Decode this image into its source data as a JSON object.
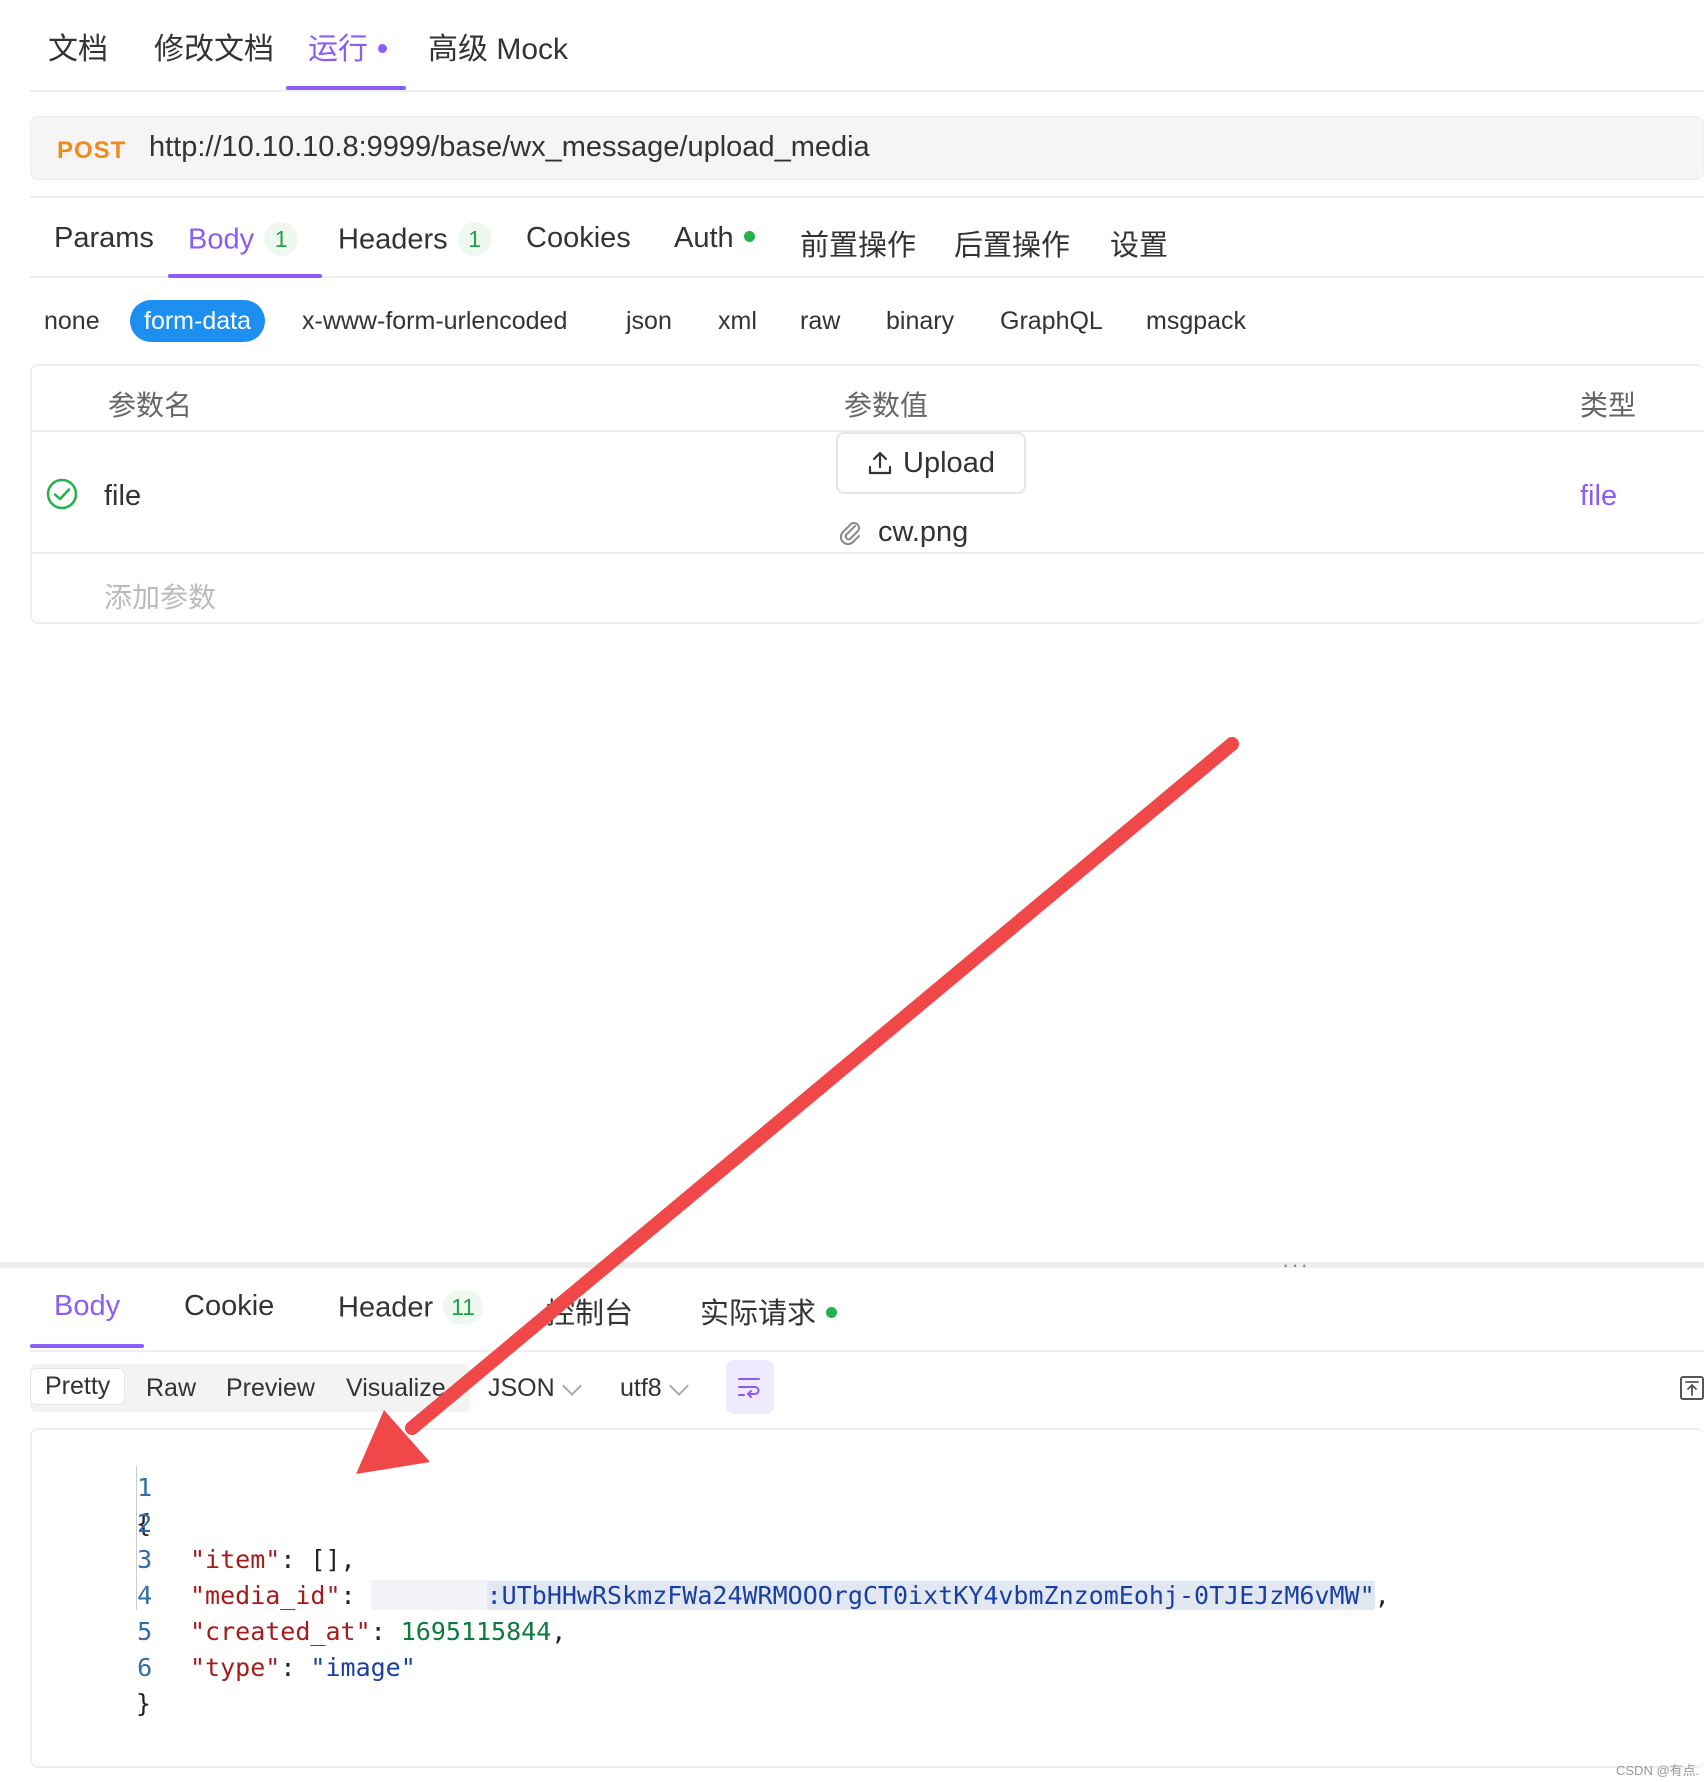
{
  "top_tabs": [
    {
      "label": "文档"
    },
    {
      "label": "修改文档"
    },
    {
      "label": "运行"
    },
    {
      "label": "高级 Mock"
    }
  ],
  "request": {
    "method": "POST",
    "url": "http://10.10.10.8:9999/base/wx_message/upload_media"
  },
  "req_tabs": [
    {
      "label": "Params"
    },
    {
      "label": "Body",
      "count": "1"
    },
    {
      "label": "Headers",
      "count": "1"
    },
    {
      "label": "Cookies"
    },
    {
      "label": "Auth"
    },
    {
      "label": "前置操作"
    },
    {
      "label": "后置操作"
    },
    {
      "label": "设置"
    }
  ],
  "body_types": [
    "none",
    "form-data",
    "x-www-form-urlencoded",
    "json",
    "xml",
    "raw",
    "binary",
    "GraphQL",
    "msgpack"
  ],
  "params_table": {
    "headers": {
      "name": "参数名",
      "value": "参数值",
      "type": "类型"
    },
    "rows": [
      {
        "name": "file",
        "upload_label": "Upload",
        "file_name": "cw.png",
        "type": "file"
      }
    ],
    "add_placeholder": "添加参数"
  },
  "splitter_dots": "···",
  "resp_tabs": [
    {
      "label": "Body"
    },
    {
      "label": "Cookie"
    },
    {
      "label": "Header",
      "count": "11"
    },
    {
      "label": "控制台"
    },
    {
      "label": "实际请求"
    }
  ],
  "resp_toolbar": {
    "views": [
      "Pretty",
      "Raw",
      "Preview",
      "Visualize"
    ],
    "format": "JSON",
    "encoding": "utf8"
  },
  "response_code": {
    "line_numbers": [
      "1",
      "2",
      "3",
      "4",
      "5",
      "6"
    ],
    "open_brace": "{",
    "close_brace": "}",
    "item_key": "\"item\"",
    "item_value": "[]",
    "media_id_key": "\"media_id\"",
    "media_id_value": ":UTbHHwRSkmzFWa24WRMOOOrgCT0ixtKY4vbmZnzomEohj-0TJEJzM6vMW\"",
    "created_at_key": "\"created_at\"",
    "created_at_value": "1695115844",
    "type_key": "\"type\"",
    "type_value": "\"image\""
  },
  "watermark": "CSDN @有点.",
  "colors": {
    "accent": "#8b5cf6",
    "active_pill": "#1d8ff0",
    "method": "#f08a1a",
    "arrow": "#f04848"
  }
}
